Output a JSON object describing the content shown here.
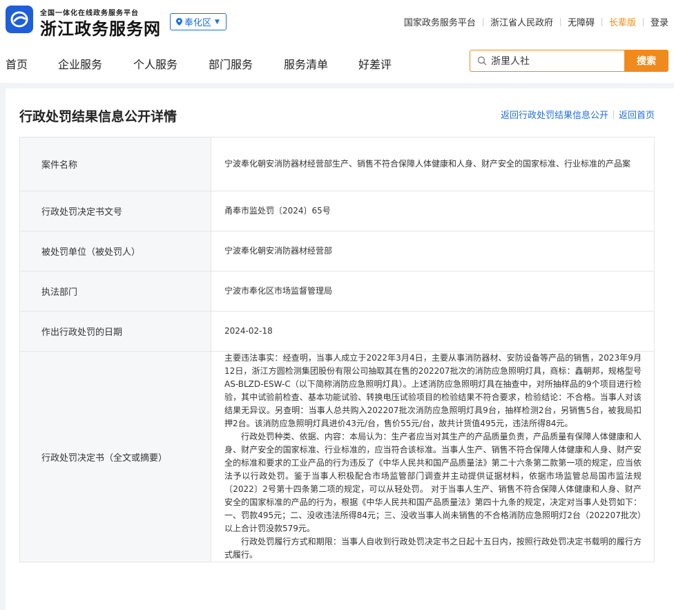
{
  "header": {
    "logo_sub": "全国一体化在线政务服务平台",
    "logo_title": "浙江政务服务网",
    "region": "奉化区",
    "top_links": [
      "国家政务服务平台",
      "浙江省人民政府",
      "无障碍",
      "长辈版",
      "登录"
    ]
  },
  "nav": {
    "items": [
      "首页",
      "企业服务",
      "个人服务",
      "部门服务",
      "服务清单",
      "好差评"
    ],
    "search_value": "浙里人社",
    "search_button": "搜索"
  },
  "page": {
    "title": "行政处罚结果信息公开详情",
    "back_links": [
      "返回行政处罚结果信息公开",
      "返回首页"
    ]
  },
  "rows": [
    {
      "label": "案件名称",
      "value": "宁波奉化朝安消防器材经营部生产、销售不符合保障人体健康和人身、财产安全的国家标准、行业标准的产品案"
    },
    {
      "label": "行政处罚决定书文号",
      "value": "甬奉市监处罚〔2024〕65号"
    },
    {
      "label": "被处罚单位（被处罚人）",
      "value": "宁波奉化朝安消防器材经营部"
    },
    {
      "label": "执法部门",
      "value": "宁波市奉化区市场监督管理局"
    },
    {
      "label": "作出行政处罚的日期",
      "value": "2024-02-18"
    }
  ],
  "decision": {
    "label": "行政处罚决定书（全文或摘要）",
    "para1": "主要违法事实：经查明，当事人成立于2022年3月4日，主要从事消防器材、安防设备等产品的销售，2023年9月12日，浙江方圆检测集团股份有限公司抽取其在售的202207批次的消防应急照明灯具，商标：鑫朝邦，规格型号AS-BLZD-ESW-C（以下简称消防应急照明灯具）。上述消防应急照明灯具在抽查中，对所抽样品的9个项目进行检验，其中试验前检查、基本功能试验、转换电压试验项目的检验结果不符合要求，检验结论：不合格。当事人对该结果无异议。另查明：当事人总共购入202207批次消防应急照明灯具9台，抽样检测2台，另销售5台，被我局扣押2台。该消防应急照明灯具进价43元/台，售价55元/台，故共计货值495元，违法所得84元。",
    "para2": "行政处罚种类、依据、内容：本局认为：生产者应当对其生产的产品质量负责，产品质量有保障人体健康和人身、财产安全的国家标准、行业标准的，应当符合该标准。当事人生产、销售不符合保障人体健康和人身、财产安全的标准和要求的工业产品的行为违反了《中华人民共和国产品质量法》第二十六条第二款第一项的规定，应当依法予以行政处罚。鉴于当事人积极配合市场监管部门调查并主动提供证据材料，依据市场监管总局国市监法规〔2022〕2号第十四条第二项的规定，可以从轻处罚。 对于当事人生产、销售不符合保障人体健康和人身、财产安全的国家标准的产品的行为，根据《中华人民共和国产品质量法》第四十九条的规定，决定对当事人处罚如下：一、罚款495元；二、没收违法所得84元；三、没收当事人尚未销售的不合格消防应急照明灯2台（202207批次）以上合计罚没款579元。",
    "para3": "行政处罚履行方式和期限：当事人自收到行政处罚决定书之日起十五日内，按照行政处罚决定书载明的履行方式履行。"
  },
  "colors": {
    "brand_blue": "#1e6fe0",
    "accent_orange": "#f08a1c"
  }
}
